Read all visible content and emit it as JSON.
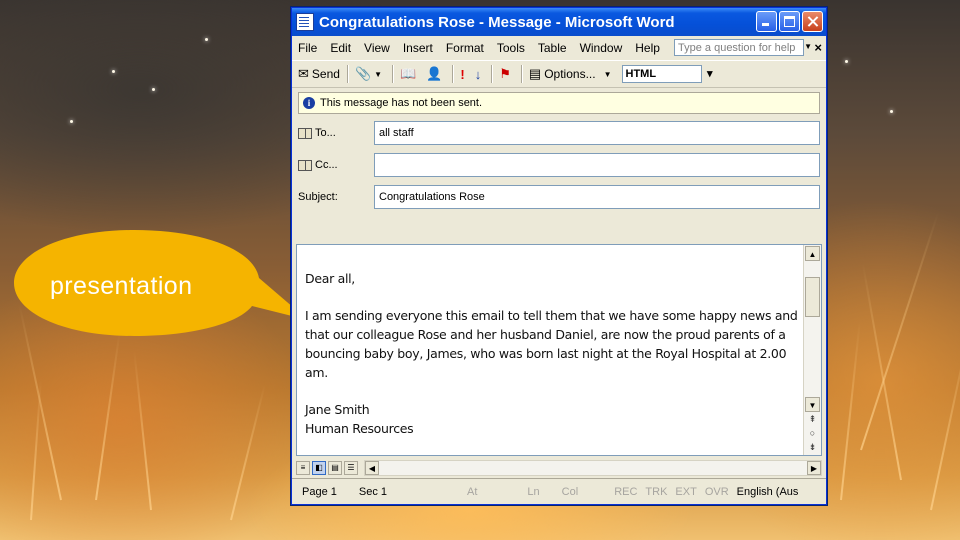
{
  "window": {
    "title": "Congratulations Rose - Message - Microsoft Word"
  },
  "menu": {
    "items": [
      "File",
      "Edit",
      "View",
      "Insert",
      "Format",
      "Tools",
      "Table",
      "Window",
      "Help"
    ],
    "help_placeholder": "Type a question for help"
  },
  "toolbar": {
    "send_label": "Send",
    "options_label": "Options...",
    "format_value": "HTML"
  },
  "infobar": {
    "text": "This message has not been sent."
  },
  "fields": {
    "to_label": "To...",
    "to_value": "all staff",
    "cc_label": "Cc...",
    "cc_value": "",
    "subject_label": "Subject:",
    "subject_value": "Congratulations Rose"
  },
  "message": {
    "greeting": "Dear all,",
    "paragraph": "I am sending everyone this email to tell them that we have some happy news and that our colleague Rose and her husband Daniel, are now the proud parents of a bouncing baby boy, James, who was born last night at the Royal Hospital at 2.00 am.",
    "signature_name": "Jane Smith",
    "signature_dept": "Human Resources"
  },
  "statusbar": {
    "page": "Page 1",
    "section": "Sec 1",
    "at": "At",
    "ln": "Ln",
    "col": "Col",
    "rec": "REC",
    "trk": "TRK",
    "ext": "EXT",
    "ovr": "OVR",
    "language": "English (Aus"
  },
  "callout": {
    "label": "presentation",
    "fill_color": "#f5b400"
  }
}
